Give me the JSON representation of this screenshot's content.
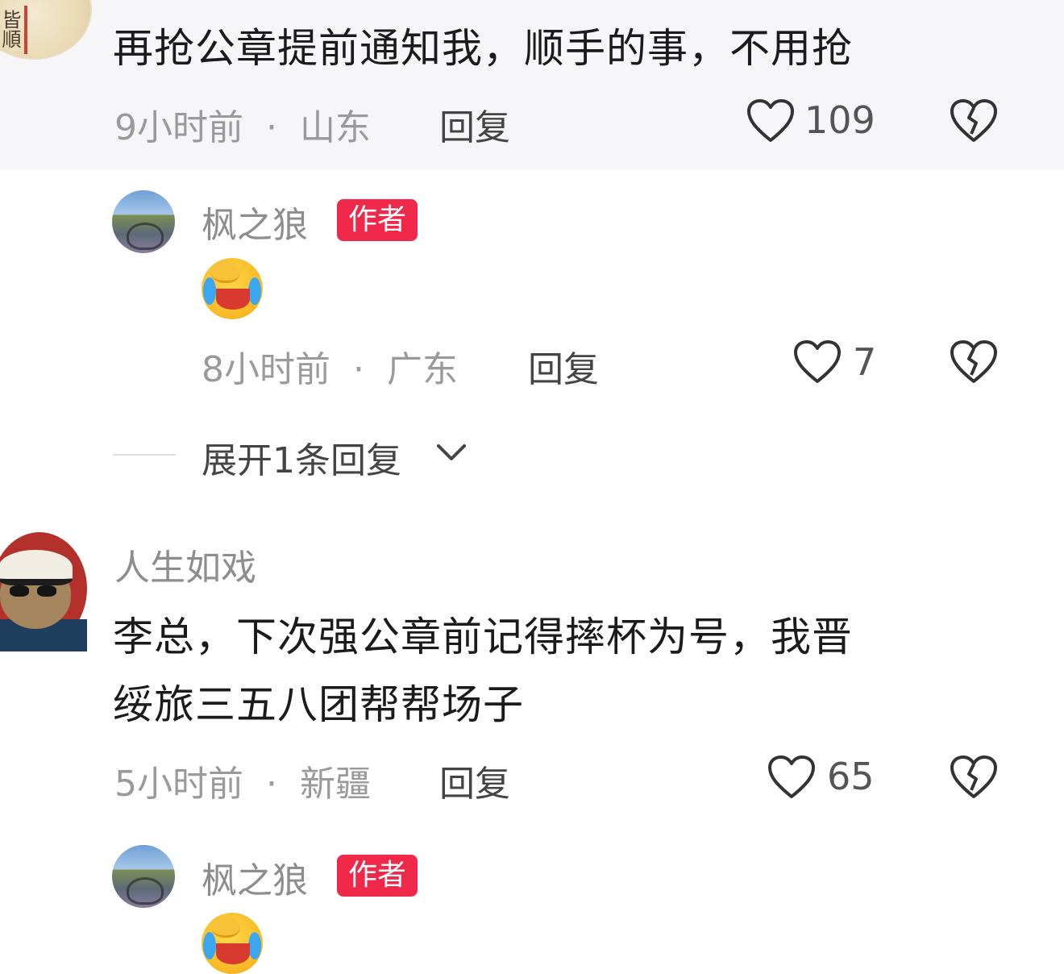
{
  "comments": [
    {
      "text": "再抢公章提前通知我，顺手的事，不用抢",
      "time": "9小时前",
      "dot": "·",
      "location": "山东",
      "reply_label": "回复",
      "likes": "109",
      "avatar_icon": "seal-avatar-icon"
    },
    {
      "username": "枫之狼",
      "badge": "作者",
      "emoji": "crying-laughing-emoji-icon",
      "time": "8小时前",
      "dot": "·",
      "location": "广东",
      "reply_label": "回复",
      "likes": "7",
      "expand_label": "展开1条回复"
    },
    {
      "username": "人生如戏",
      "text_line1": "李总，下次强公章前记得摔杯为号，我晋",
      "text_line2": "绥旅三五八团帮帮场子",
      "time": "5小时前",
      "dot": "·",
      "location": "新疆",
      "reply_label": "回复",
      "likes": "65"
    },
    {
      "username": "枫之狼",
      "badge": "作者",
      "emoji": "crying-laughing-emoji-icon"
    }
  ],
  "colors": {
    "badge_bg": "#f0284a",
    "highlight_bg": "#f6f6f8",
    "meta_text": "#9a9a9a"
  }
}
